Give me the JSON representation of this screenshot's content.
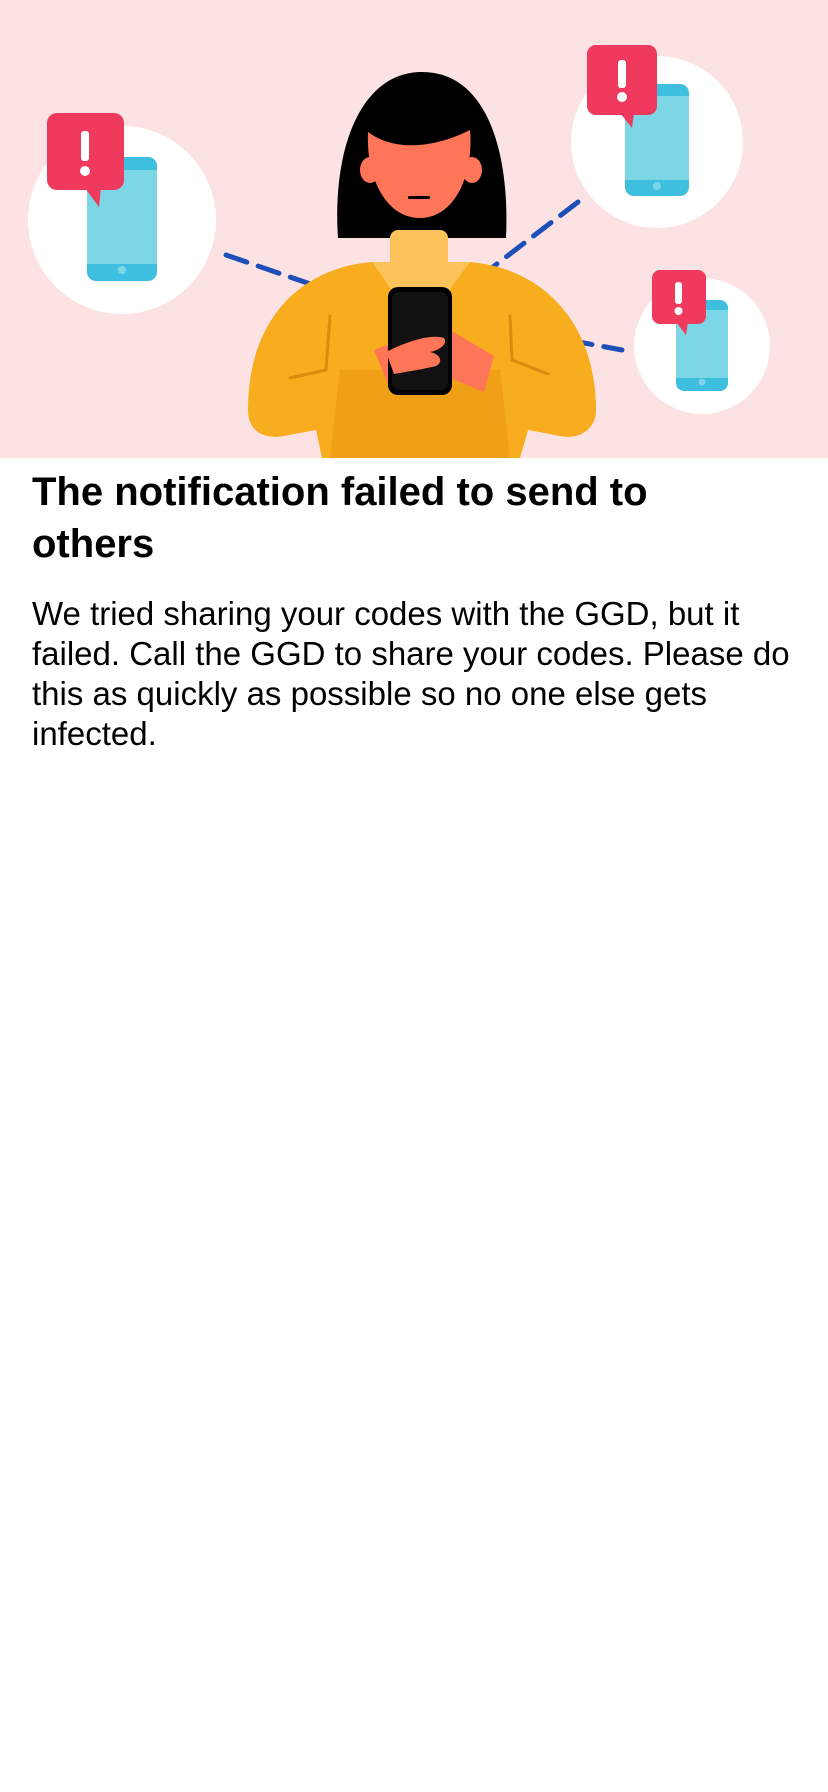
{
  "illustration": {
    "icon": "person-notification-illustration",
    "alert_glyph": "!",
    "colors": {
      "background": "#fde2e3",
      "alert_bubble": "#ef3a5d",
      "phone_screen": "#7dd6e6",
      "phone_frame": "#3fbfe0",
      "sweater": "#f7ad1e",
      "skin": "#ff7557",
      "hair": "#000000",
      "dashed_line": "#1d4fb8"
    }
  },
  "message": {
    "title": "The notification failed to send to others",
    "body": "We tried sharing your codes with the GGD, but it failed. Call the GGD to share your codes. Please do this as quickly as possible so no one else gets infected."
  }
}
